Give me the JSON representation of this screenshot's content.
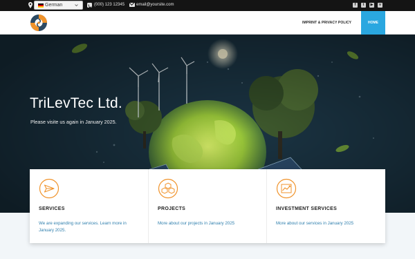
{
  "topbar": {
    "language": "German",
    "phone": "(000) 123 12345",
    "email": "email@yoursite.com",
    "social_icons": [
      "facebook-icon",
      "twitter-icon",
      "youtube-icon",
      "vimeo-icon"
    ]
  },
  "nav": {
    "items": [
      {
        "label": "IMPRINT & PRIVACY POLICY"
      },
      {
        "label": "HOME"
      }
    ]
  },
  "hero": {
    "title": "TriLevTec Ltd.",
    "subtitle": "Please visite us again in January 2025."
  },
  "cards": [
    {
      "icon": "send-icon",
      "title": "SERVICES",
      "description": "We are expanding our services. Learn more in January 2025."
    },
    {
      "icon": "cubes-icon",
      "title": "PROJECTS",
      "description": "More about our projects in January 2025"
    },
    {
      "icon": "chart-icon",
      "title": "INVESTMENT SERVICES",
      "description": "More about our services in January 2025"
    }
  ],
  "colors": {
    "accent": "#2aa7e0",
    "icon_orange": "#f0932b",
    "link_blue": "#2f7fad",
    "topbar_bg": "#141414"
  }
}
